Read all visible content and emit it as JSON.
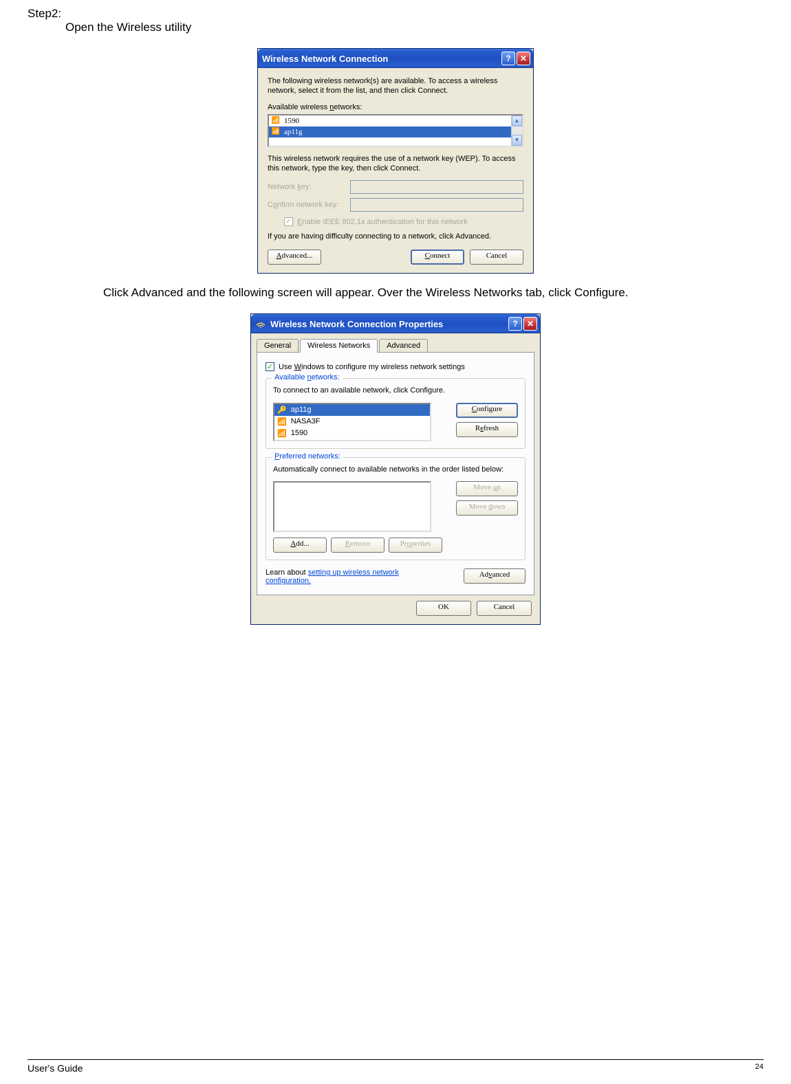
{
  "doc": {
    "step_label": "Step2:",
    "step_text": "Open the Wireless utility",
    "body_text": "Click Advanced and the following screen will appear. Over the Wireless Networks tab, click Configure.",
    "footer_label": "User's Guide",
    "page_number": "24"
  },
  "dialog1": {
    "title": "Wireless Network Connection",
    "intro": "The following wireless network(s) are available. To access a wireless network, select it from the list, and then click Connect.",
    "available_label": "Available wireless networks:",
    "networks": [
      {
        "name": "1590",
        "selected": false
      },
      {
        "name": "ap11g",
        "selected": true
      }
    ],
    "wep_text": "This wireless network requires the use of a network key (WEP). To access this network, type the key, then click Connect.",
    "network_key_label": "Network key:",
    "confirm_key_label": "Confirm network key:",
    "enable_8021x_label": "Enable IEEE 802.1x authentication for this network",
    "difficulty_text": "If you are having difficulty connecting to a network, click Advanced.",
    "btn_advanced": "Advanced...",
    "btn_connect": "Connect",
    "btn_cancel": "Cancel"
  },
  "dialog2": {
    "title": "Wireless Network Connection Properties",
    "tabs": {
      "general": "General",
      "wireless": "Wireless Networks",
      "advanced": "Advanced"
    },
    "use_windows_label": "Use Windows to configure my wireless network settings",
    "available_legend": "Available networks:",
    "available_text": "To connect to an available network, click Configure.",
    "available_list": [
      {
        "name": "ap11g",
        "icon": "cert",
        "selected": true
      },
      {
        "name": "NASA3F",
        "icon": "net",
        "selected": false
      },
      {
        "name": "1590",
        "icon": "net",
        "selected": false
      }
    ],
    "btn_configure": "Configure",
    "btn_refresh": "Refresh",
    "preferred_legend": "Preferred networks:",
    "preferred_text": "Automatically connect to available networks in the order listed below:",
    "btn_moveup": "Move up",
    "btn_movedown": "Move down",
    "btn_add": "Add...",
    "btn_remove": "Remove",
    "btn_properties": "Properties",
    "learn_text1": "Learn about ",
    "learn_link": "setting up wireless network configuration.",
    "btn_advanced2": "Advanced",
    "btn_ok": "OK",
    "btn_cancel": "Cancel"
  }
}
